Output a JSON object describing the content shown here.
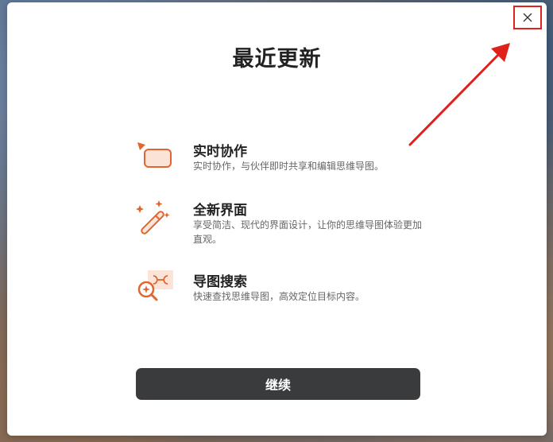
{
  "dialog": {
    "title": "最近更新",
    "close_icon": "close-icon",
    "continue_label": "继续"
  },
  "features": [
    {
      "icon": "collaboration-icon",
      "name": "实时协作",
      "desc": "实时协作，与伙伴即时共享和编辑思维导图。"
    },
    {
      "icon": "magic-wand-icon",
      "name": "全新界面",
      "desc": "享受简洁、现代的界面设计，让你的思维导图体验更加直观。"
    },
    {
      "icon": "map-search-icon",
      "name": "导图搜索",
      "desc": "快速查找思维导图，高效定位目标内容。"
    }
  ],
  "colors": {
    "accent": "#e0652e",
    "annotation_red": "#e0201b",
    "button_bg": "#3a3b3d"
  }
}
